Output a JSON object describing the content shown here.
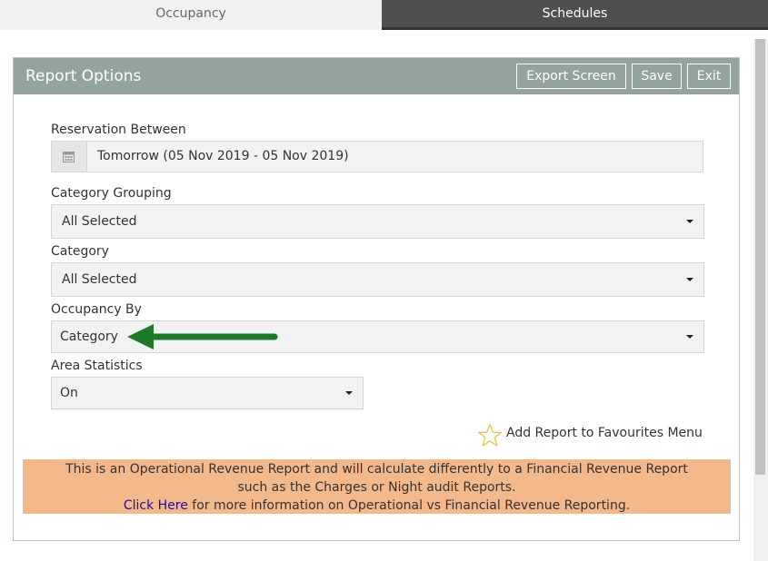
{
  "tabs": [
    {
      "label": "Occupancy",
      "active": true
    },
    {
      "label": "Schedules",
      "active": false
    }
  ],
  "panel": {
    "title": "Report Options",
    "buttons": {
      "export": "Export Screen",
      "save": "Save",
      "exit": "Exit"
    }
  },
  "fields": {
    "reservation": {
      "label": "Reservation Between",
      "value": "Tomorrow (05 Nov 2019 - 05 Nov 2019)",
      "icon": "calendar-icon"
    },
    "category_grouping": {
      "label": "Category Grouping",
      "value": "All Selected"
    },
    "category": {
      "label": "Category",
      "value": "All Selected"
    },
    "occupancy_by": {
      "label": "Occupancy By",
      "value": "Category"
    },
    "area_statistics": {
      "label": "Area Statistics",
      "value": "On"
    }
  },
  "favourites": {
    "label": "Add Report to Favourites Menu",
    "icon": "star-icon"
  },
  "notice": {
    "line1": "This is an Operational Revenue Report and will calculate differently to a Financial Revenue Report",
    "line2": "such as the Charges or Night audit Reports.",
    "link": "Click Here",
    "line3": " for more information on Operational vs Financial Revenue Reporting."
  },
  "colors": {
    "header": "#93a3a0",
    "notice_bg": "#f4b98a",
    "tab_dark": "#4f4f4f",
    "arrow": "#1e7a26",
    "link": "#1a0dab"
  }
}
